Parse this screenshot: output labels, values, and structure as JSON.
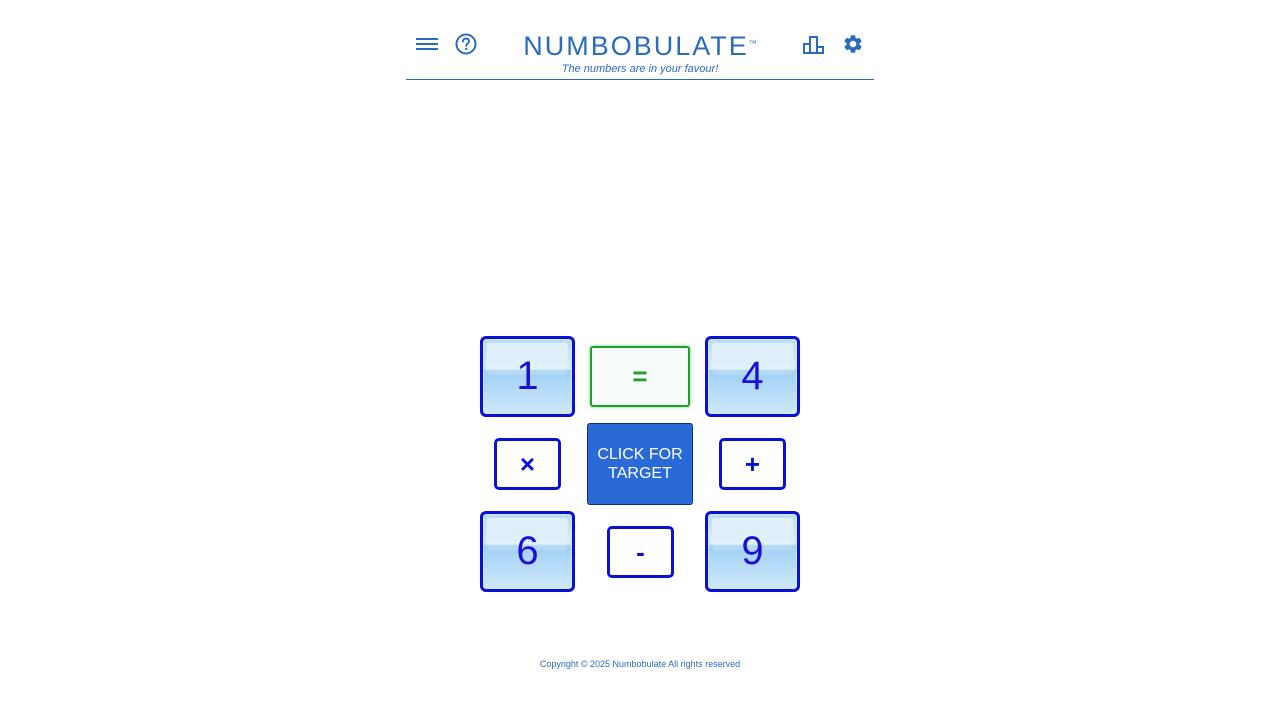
{
  "header": {
    "title": "NUMBOBULATE",
    "trademark": "™",
    "tagline": "The numbers are in your favour!",
    "icons": {
      "menu": "menu-icon",
      "help": "help-icon",
      "stats": "stats-icon",
      "settings": "settings-icon"
    }
  },
  "game": {
    "tiles": [
      {
        "value": "1"
      },
      {
        "value": "4"
      },
      {
        "value": "6"
      },
      {
        "value": "9"
      }
    ],
    "operators": {
      "multiply": "×",
      "add": "+",
      "subtract": "-"
    },
    "equals": "=",
    "target_button": "CLICK FOR\nTARGET"
  },
  "footer": {
    "copyright": "Copyright © 2025 Numbobulate All rights reserved"
  },
  "colors": {
    "brand": "#2a6bbf",
    "tile_border": "#0a10d4",
    "equals": "#1e9e2a",
    "target_bg": "#2a6ad6"
  }
}
